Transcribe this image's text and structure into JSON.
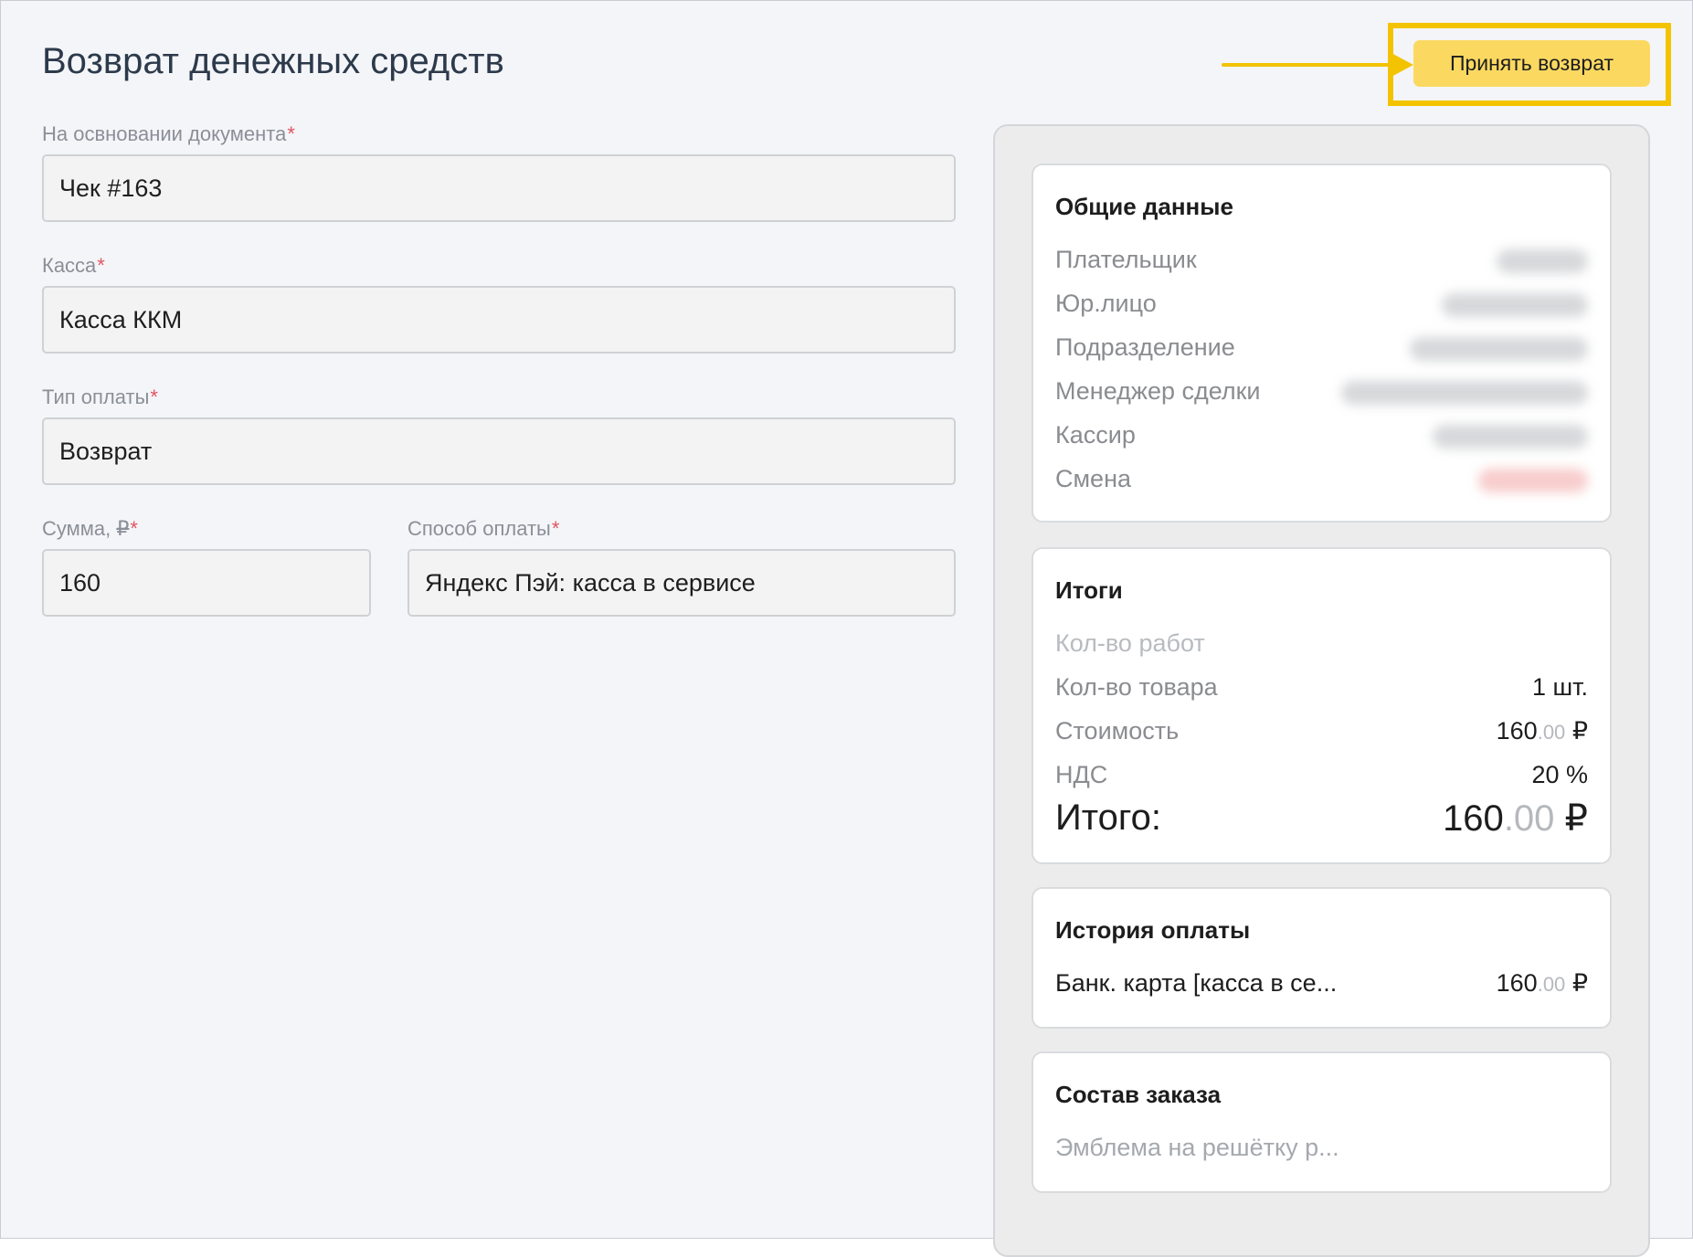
{
  "page": {
    "title": "Возврат денежных средств",
    "accept_button": "Принять возврат",
    "accent_color": "#f3c300",
    "button_color": "#fbd961"
  },
  "form": {
    "document": {
      "label": "На освновании документа",
      "required": "*",
      "value": "Чек #163"
    },
    "cashbox": {
      "label": "Касса",
      "required": "*",
      "value": "Касса ККМ"
    },
    "payment_type": {
      "label": "Тип оплаты",
      "required": "*",
      "value": "Возврат"
    },
    "amount": {
      "label": "Сумма, ",
      "currency": "₽",
      "required": "*",
      "value": "160"
    },
    "payment_method": {
      "label": "Способ оплаты",
      "required": "*",
      "value": "Яндекс Пэй: касса в сервисе"
    }
  },
  "general": {
    "title": "Общие данные",
    "rows": [
      {
        "label": "Плательщик"
      },
      {
        "label": "Юр.лицо"
      },
      {
        "label": "Подразделение"
      },
      {
        "label": "Менеджер сделки"
      },
      {
        "label": "Кассир"
      },
      {
        "label": "Смена"
      }
    ]
  },
  "totals": {
    "title": "Итоги",
    "works_label": "Кол-во работ",
    "goods_label": "Кол-во товара",
    "goods_value": "1 шт.",
    "cost_label": "Стоимость",
    "cost_int": "160",
    "cost_cents": ".00",
    "currency": "₽",
    "vat_label": "НДС",
    "vat_value": "20 %",
    "total_label": "Итого:",
    "total_int": "160",
    "total_cents": ".00"
  },
  "history": {
    "title": "История оплаты",
    "item_label": "Банк. карта [касса в се...",
    "item_int": "160",
    "item_cents": ".00",
    "currency": "₽"
  },
  "order": {
    "title": "Состав заказа",
    "item": "Эмблема на решётку р..."
  }
}
